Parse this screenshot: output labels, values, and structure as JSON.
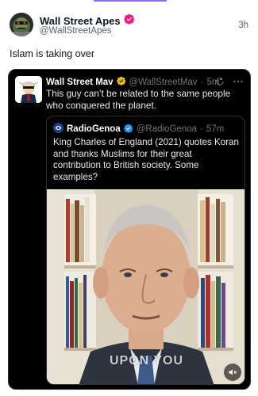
{
  "post": {
    "author_name": "Wall Street Apes",
    "author_handle": "@WallStreetApes",
    "time": "3h",
    "text": "Islam is taking over"
  },
  "quote": {
    "author_name": "Wall Street Mav",
    "author_handle": "@WallStreetMav",
    "time": "5m",
    "separator": "·",
    "text": "This guy can’t be related to the same people who conquered the planet."
  },
  "inner_quote": {
    "author_name": "RadioGenoa",
    "author_handle": "@RadioGenoa",
    "time": "57m",
    "separator": "·",
    "text": "King Charles of England (2021) quotes Koran and thanks Muslims for their great contribution to British society. Some examples?"
  },
  "video": {
    "caption": "UPON YOU"
  },
  "icons": {
    "verified_pink": "verified-badge-icon",
    "verified_gold": "verified-badge-icon",
    "verified_blue": "verified-badge-icon",
    "refresh": "refresh-icon",
    "more": "more-icon",
    "mute": "speaker-mute-icon"
  },
  "colors": {
    "accent": "#8a6cf0",
    "verified_pink": "#f91880",
    "verified_gold": "#e8b829",
    "verified_blue": "#1d9bf0",
    "muted_text": "#536471"
  }
}
